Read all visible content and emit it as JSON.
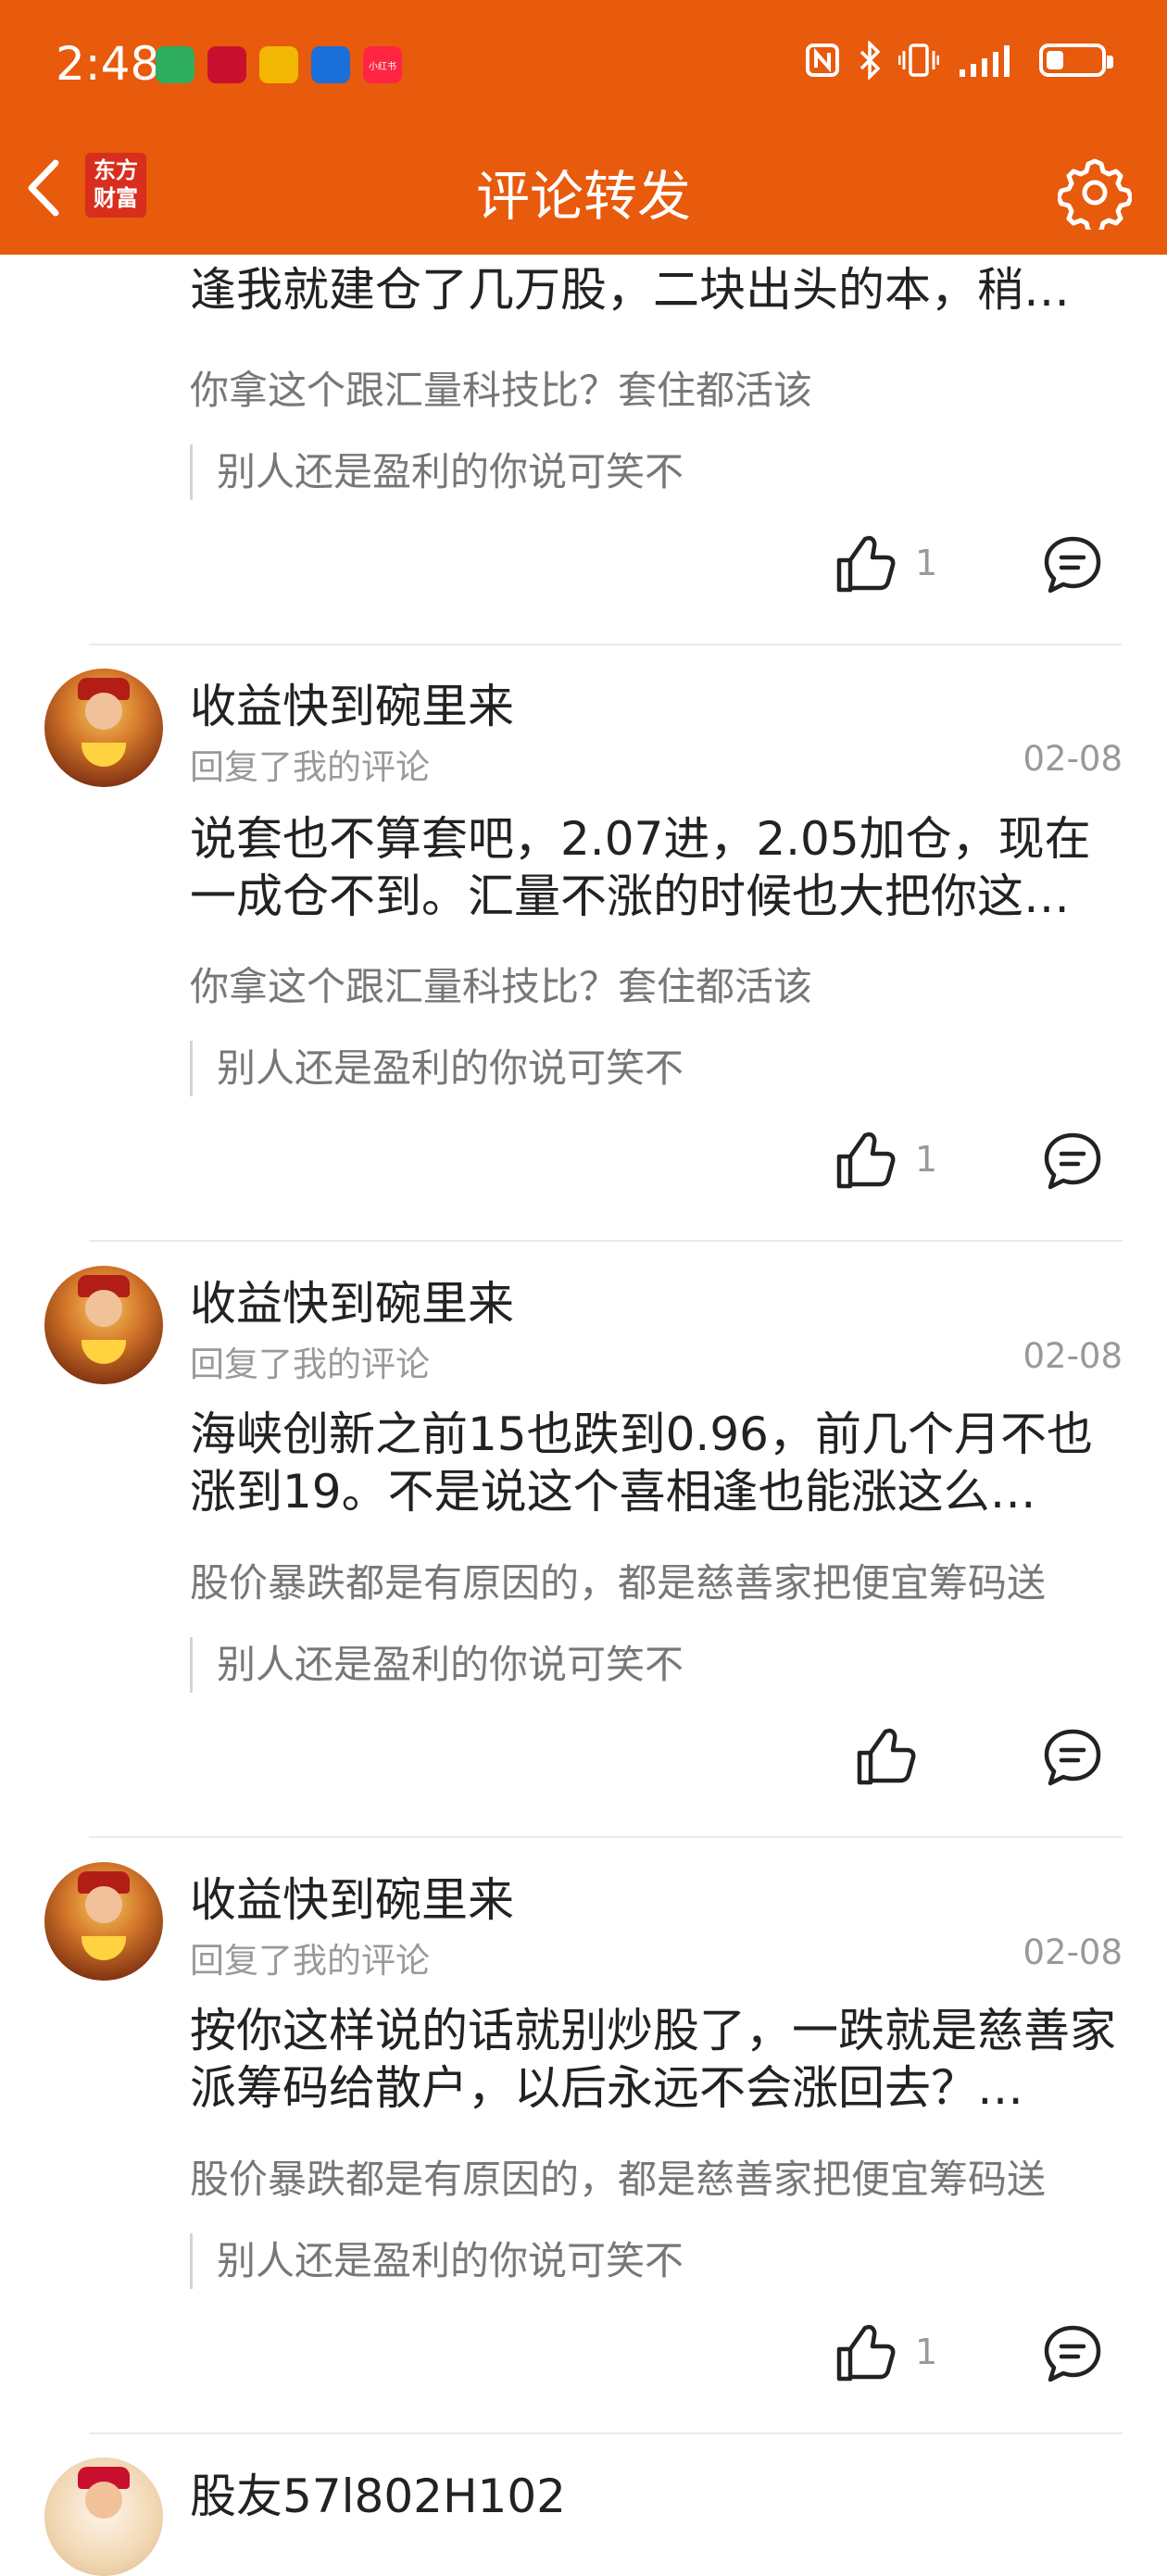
{
  "status_bar": {
    "time": "2:48",
    "notif_icons": [
      "app-icon",
      "app-icon",
      "mail-icon",
      "app-icon",
      "小红书"
    ],
    "status_icons": [
      "nfc-icon",
      "bluetooth-icon",
      "vibrate-icon",
      "signal-icon",
      "battery-icon"
    ]
  },
  "header": {
    "title": "评论转发",
    "logo_line1": "东方",
    "logo_line2": "财富",
    "accent": "#E85A0C"
  },
  "comments": [
    {
      "text": "你在三了一些粉丝了一只不过活该。这个喜相逢我就建仓了几万股，二块出头的本，稍…",
      "original": "你拿这个跟汇量科技比？套住都活该",
      "quote": "别人还是盈利的你说可笑不",
      "likes": "1"
    },
    {
      "username": "收益快到碗里来",
      "reply_label": "回复了我的评论",
      "date": "02-08",
      "text": "说套也不算套吧，2.07进，2.05加仓，现在一成仓不到。汇量不涨的时候也大把你这…",
      "original": "你拿这个跟汇量科技比？套住都活该",
      "quote": "别人还是盈利的你说可笑不",
      "likes": "1"
    },
    {
      "username": "收益快到碗里来",
      "reply_label": "回复了我的评论",
      "date": "02-08",
      "text": "海峡创新之前15也跌到0.96，前几个月不也涨到19。不是说这个喜相逢也能涨这么…",
      "original": "股价暴跌都是有原因的，都是慈善家把便宜筹码送",
      "quote": "别人还是盈利的你说可笑不",
      "likes": ""
    },
    {
      "username": "收益快到碗里来",
      "reply_label": "回复了我的评论",
      "date": "02-08",
      "text": "按你这样说的话就别炒股了，一跌就是慈善家派筹码给散户，以后永远不会涨回去？…",
      "original": "股价暴跌都是有原因的，都是慈善家把便宜筹码送",
      "quote": "别人还是盈利的你说可笑不",
      "likes": "1"
    },
    {
      "username": "股友57l802H102"
    }
  ]
}
